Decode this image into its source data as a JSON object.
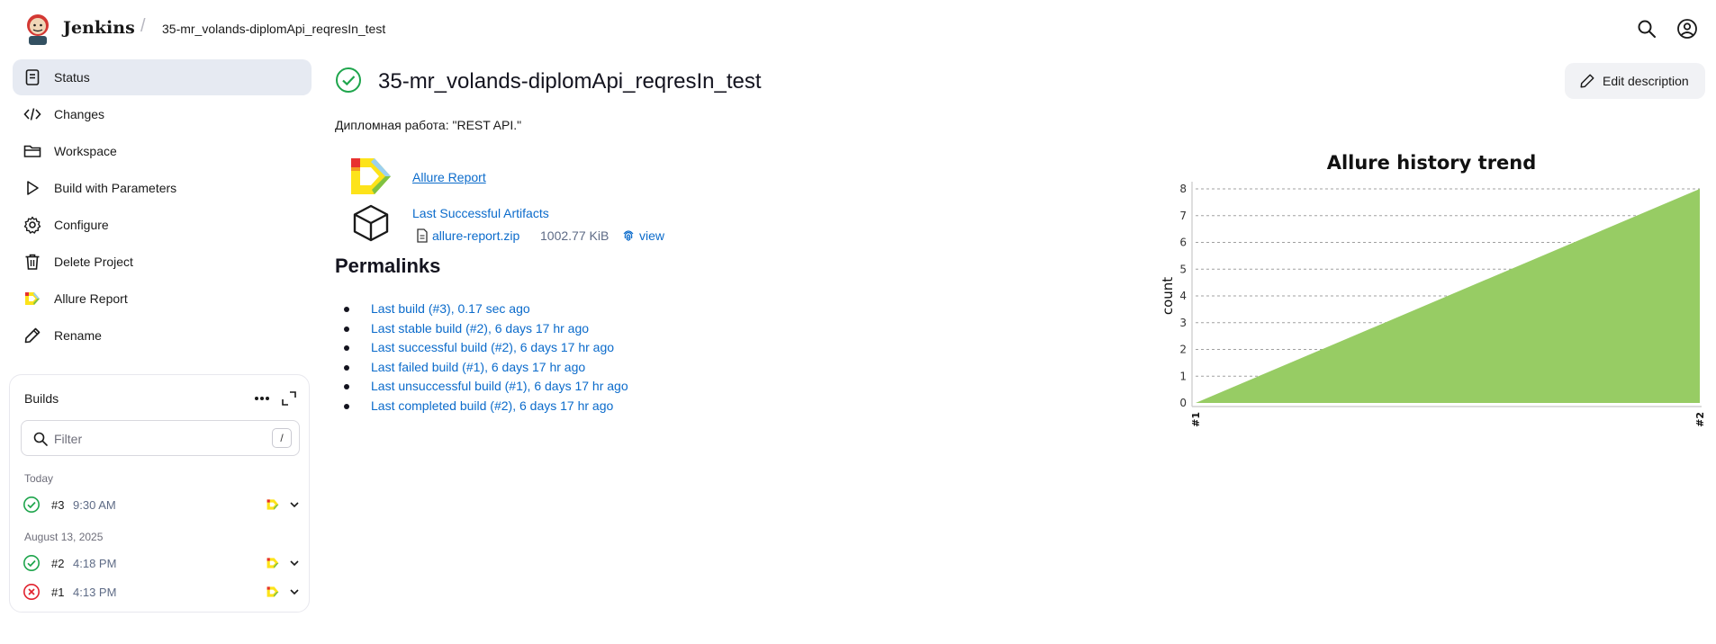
{
  "header": {
    "brand": "Jenkins",
    "breadcrumb": "35-mr_volands-diplomApi_reqresIn_test",
    "icons": [
      "search-icon",
      "user-icon"
    ]
  },
  "sidebar": {
    "items": [
      {
        "label": "Status",
        "icon": "status-icon",
        "active": true
      },
      {
        "label": "Changes",
        "icon": "code-icon"
      },
      {
        "label": "Workspace",
        "icon": "folder-icon"
      },
      {
        "label": "Build with Parameters",
        "icon": "play-icon"
      },
      {
        "label": "Configure",
        "icon": "gear-icon"
      },
      {
        "label": "Delete Project",
        "icon": "trash-icon"
      },
      {
        "label": "Allure Report",
        "icon": "allure-icon"
      },
      {
        "label": "Rename",
        "icon": "pencil-icon"
      }
    ]
  },
  "builds": {
    "title": "Builds",
    "filter_placeholder": "Filter",
    "filter_shortcut": "/",
    "groups": [
      {
        "label": "Today",
        "rows": [
          {
            "number": "#3",
            "time": "9:30 AM",
            "status": "success"
          }
        ]
      },
      {
        "label": "August 13, 2025",
        "rows": [
          {
            "number": "#2",
            "time": "4:18 PM",
            "status": "success"
          },
          {
            "number": "#1",
            "time": "4:13 PM",
            "status": "failed"
          }
        ]
      }
    ]
  },
  "main": {
    "title": "35-mr_volands-diplomApi_reqresIn_test",
    "edit_description": "Edit description",
    "description": "Дипломная работа: \"REST API.\"",
    "allure_report_link": "Allure Report",
    "last_successful_artifacts": "Last Successful Artifacts",
    "artifact": {
      "name": "allure-report.zip",
      "size": "1002.77 KiB",
      "view": "view"
    },
    "permalinks_title": "Permalinks",
    "permalinks": [
      "Last build (#3), 0.17 sec ago",
      "Last stable build (#2), 6 days 17 hr ago",
      "Last successful build (#2), 6 days 17 hr ago",
      "Last failed build (#1), 6 days 17 hr ago",
      "Last unsuccessful build (#1), 6 days 17 hr ago",
      "Last completed build (#2), 6 days 17 hr ago"
    ]
  },
  "colors": {
    "accent_link": "#0b6bcb",
    "success": "#1ea54c",
    "failed": "#e1222e",
    "chart_fill": "#97cc64"
  },
  "chart_data": {
    "type": "area",
    "title": "Allure history trend",
    "xlabel": "",
    "ylabel": "count",
    "categories": [
      "#1",
      "#2"
    ],
    "series": [
      {
        "values": [
          0,
          8
        ]
      }
    ],
    "ylim": [
      0,
      8
    ],
    "yticks": [
      0,
      1,
      2,
      3,
      4,
      5,
      6,
      7,
      8
    ],
    "grid": true
  }
}
